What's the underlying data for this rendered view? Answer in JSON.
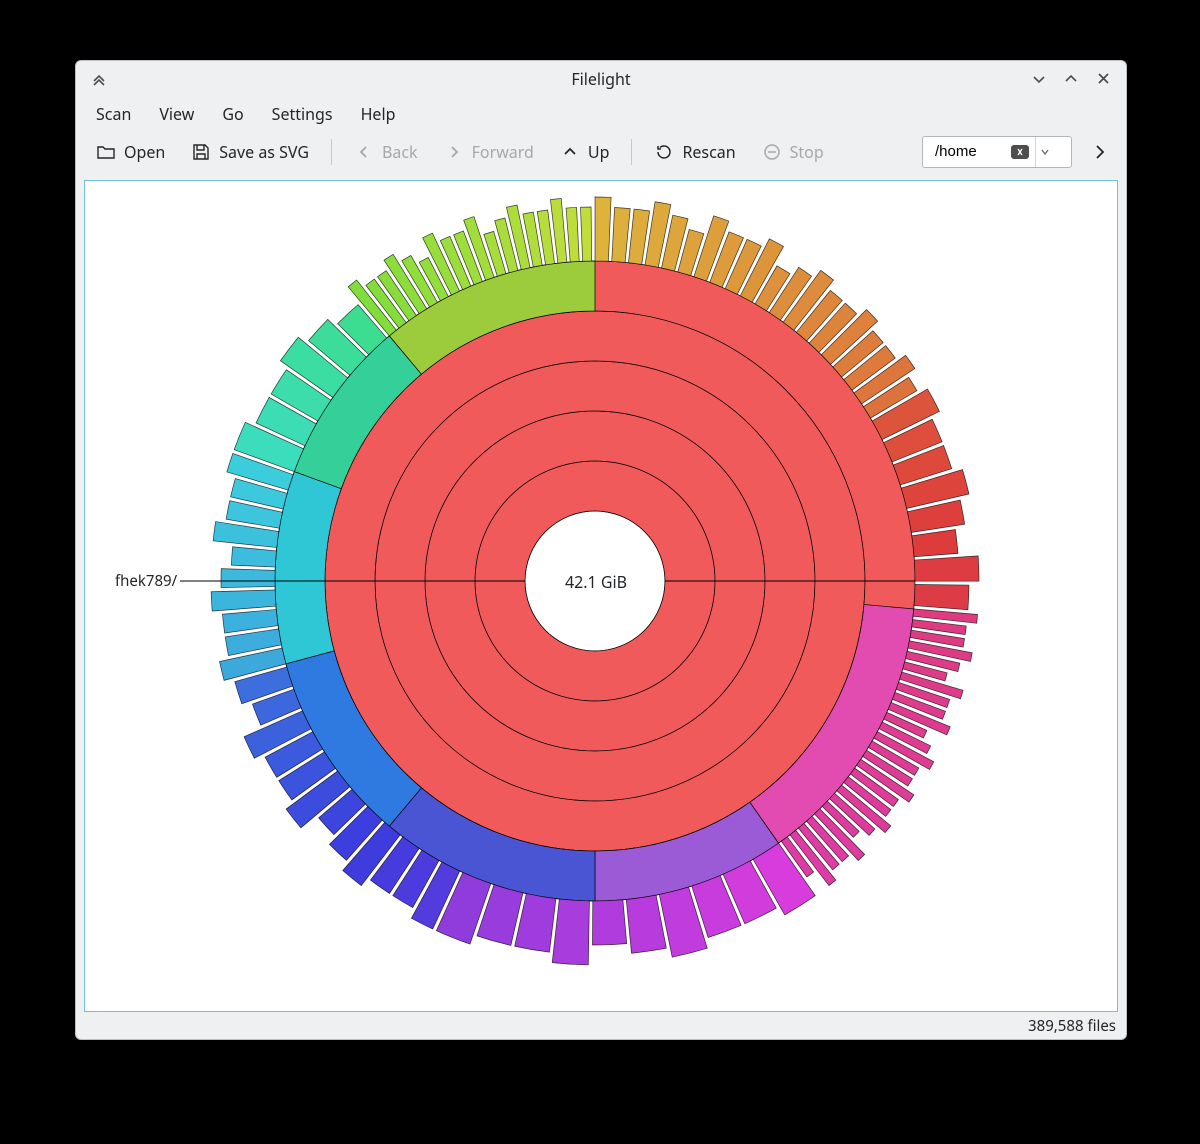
{
  "window": {
    "title": "Filelight"
  },
  "menubar": {
    "scan": "Scan",
    "view": "View",
    "go": "Go",
    "settings": "Settings",
    "help": "Help"
  },
  "toolbar": {
    "open": "Open",
    "save_svg": "Save as SVG",
    "back": "Back",
    "forward": "Forward",
    "up": "Up",
    "rescan": "Rescan",
    "stop": "Stop"
  },
  "pathbar": {
    "value": "/home"
  },
  "status": {
    "file_count": "389,588 files"
  },
  "chart_data": {
    "type": "sunburst",
    "center_label": "42.1 GiB",
    "pointer_label": "fhek789/",
    "rings": {
      "inner_radius": 70,
      "ring_count": 6,
      "ring_thickness": 50
    },
    "root_span_deg": 360,
    "root_color": "#f05a5a",
    "outer_segments": [
      {
        "start_deg": -90,
        "end_deg": -30,
        "hue_start": 45,
        "hue_end": 20,
        "slivers": 20
      },
      {
        "start_deg": -30,
        "end_deg": 5,
        "hue_start": 10,
        "hue_end": 355,
        "slivers": 8
      },
      {
        "start_deg": 5,
        "end_deg": 55,
        "hue_start": 335,
        "hue_end": 320,
        "slivers": 26
      },
      {
        "start_deg": 55,
        "end_deg": 115,
        "hue_start": 300,
        "hue_end": 270,
        "slivers": 10
      },
      {
        "start_deg": 115,
        "end_deg": 165,
        "hue_start": 250,
        "hue_end": 220,
        "slivers": 12
      },
      {
        "start_deg": 165,
        "end_deg": 200,
        "hue_start": 200,
        "hue_end": 185,
        "slivers": 10
      },
      {
        "start_deg": 200,
        "end_deg": 230,
        "hue_start": 170,
        "hue_end": 150,
        "slivers": 6
      },
      {
        "start_deg": 230,
        "end_deg": 270,
        "hue_start": 95,
        "hue_end": 70,
        "slivers": 18
      }
    ],
    "mid_segments": [
      {
        "start_deg": 55,
        "end_deg": 90,
        "color": "#9b5bd6"
      },
      {
        "start_deg": 90,
        "end_deg": 130,
        "color": "#4a55d4"
      },
      {
        "start_deg": 130,
        "end_deg": 165,
        "color": "#2f7ae0"
      },
      {
        "start_deg": 165,
        "end_deg": 200,
        "color": "#2fc7d6"
      },
      {
        "start_deg": 200,
        "end_deg": 230,
        "color": "#35cf9a"
      },
      {
        "start_deg": 230,
        "end_deg": 270,
        "color": "#9ccb3c"
      },
      {
        "start_deg": 5,
        "end_deg": 55,
        "color": "#e24bb0"
      },
      {
        "start_deg": -30,
        "end_deg": 5,
        "color": "#f05a5a"
      },
      {
        "start_deg": -90,
        "end_deg": -30,
        "color": "#f05a5a"
      }
    ]
  }
}
